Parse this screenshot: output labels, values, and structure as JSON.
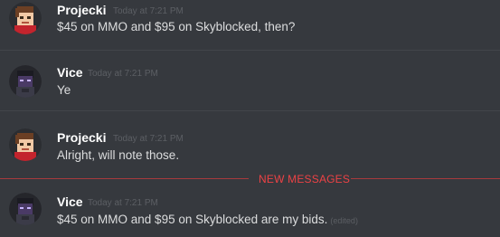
{
  "messages": [
    {
      "author": "Projecki",
      "timestamp": "Today at 7:21 PM",
      "text": "$45 on MMO and $95 on Skyblocked, then?",
      "avatar": "projecki-avatar-icon"
    },
    {
      "author": "Vice",
      "timestamp": "Today at 7:21 PM",
      "text": "Ye",
      "avatar": "vice-avatar-icon"
    },
    {
      "author": "Projecki",
      "timestamp": "Today at 7:21 PM",
      "text": "Alright, will note those.",
      "avatar": "projecki-avatar-icon"
    },
    {
      "author": "Vice",
      "timestamp": "Today at 7:21 PM",
      "text": "$45 on MMO and $95 on Skyblocked are my bids.",
      "edited": "(edited)",
      "avatar": "vice-avatar-icon"
    }
  ],
  "new_messages_label": "NEW MESSAGES",
  "colors": {
    "background": "#36393e",
    "username": "#ffffff",
    "message_text": "#dcddde",
    "timestamp": "#5c5f64",
    "new_messages_accent": "#ed4245"
  }
}
